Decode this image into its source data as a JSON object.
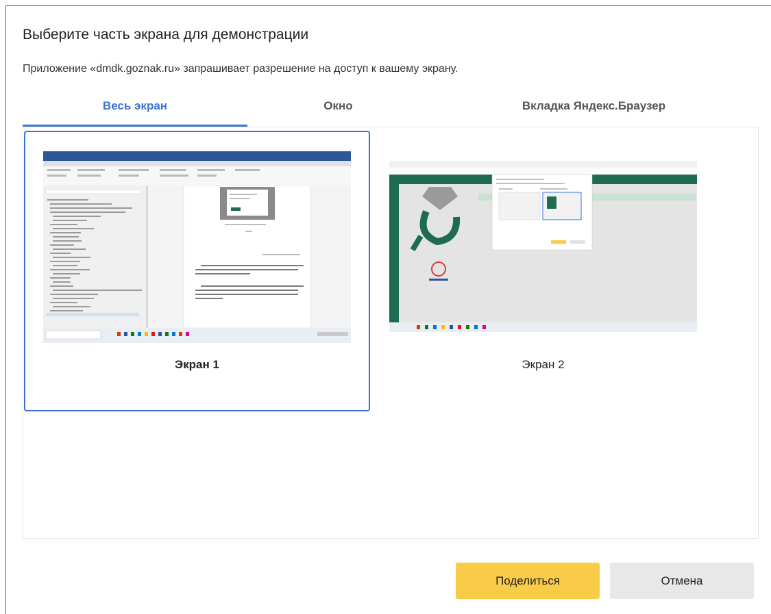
{
  "dialog": {
    "title": "Выберите часть экрана для демонстрации",
    "subtitle": "Приложение «dmdk.goznak.ru» запрашивает разрешение на доступ к вашему экрану."
  },
  "tabs": [
    {
      "label": "Весь экран",
      "active": true
    },
    {
      "label": "Окно",
      "active": false
    },
    {
      "label": "Вкладка Яндекс.Браузер",
      "active": false
    }
  ],
  "screens": [
    {
      "label": "Экран 1",
      "selected": true
    },
    {
      "label": "Экран 2",
      "selected": false
    }
  ],
  "buttons": {
    "share": "Поделиться",
    "cancel": "Отмена"
  },
  "colors": {
    "accent": "#3b72d9",
    "share_button": "#f8cc46",
    "cancel_button": "#e8e8e8",
    "app_green": "#1f6b4f"
  }
}
